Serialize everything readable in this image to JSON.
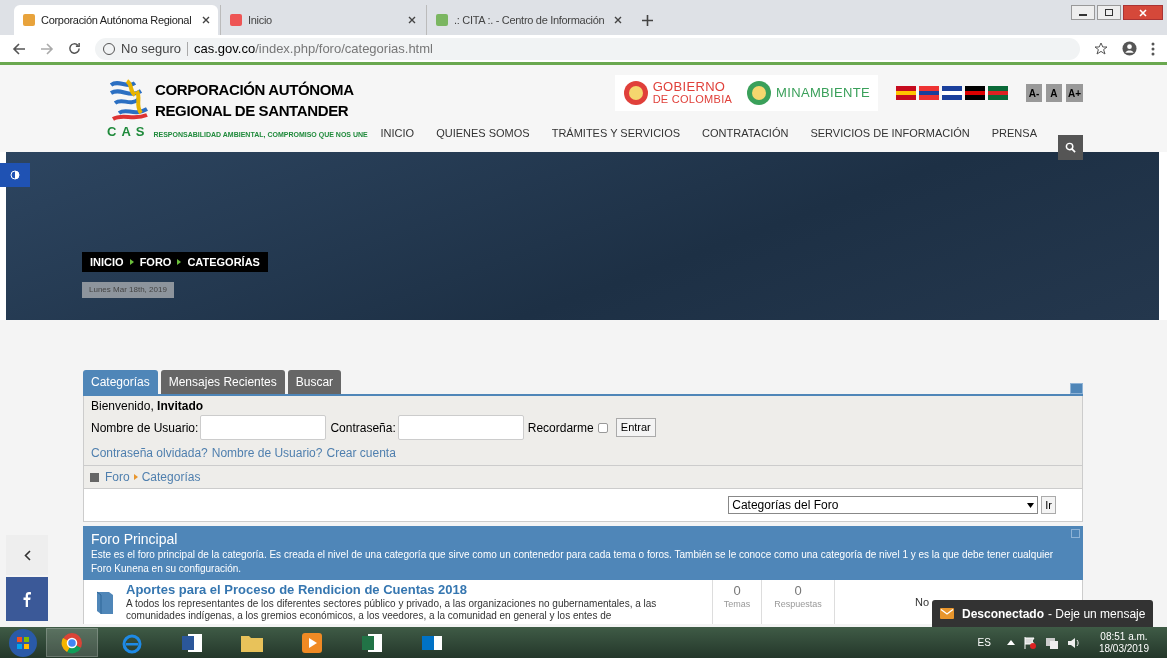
{
  "browser": {
    "tabs": [
      {
        "title": "Corporación Autónoma Regional",
        "selected": true
      },
      {
        "title": "Inicio",
        "selected": false
      },
      {
        "title": ".: CITA :. - Centro de Información",
        "selected": false
      }
    ],
    "security": "No seguro",
    "url_host": "cas.gov.co",
    "url_path": "/index.php/foro/categorias.html"
  },
  "header": {
    "logo_title": [
      "CORPORACIÓN AUTÓNOMA",
      "REGIONAL DE SANTANDER"
    ],
    "logo_letters": "CAS",
    "logo_slogan": "RESPONSABILIDAD AMBIENTAL, COMPROMISO QUE NOS UNE",
    "partners": [
      {
        "line1": "GOBIERNO",
        "line2": "DE COLOMBIA",
        "color": "#e0403a"
      },
      {
        "line1": "MINAMBIENTE",
        "color": "#3aa05a"
      }
    ],
    "font_buttons": [
      "A-",
      "A",
      "A+"
    ],
    "nav": [
      "INICIO",
      "QUIENES SOMOS",
      "TRÁMITES Y SERVICIOS",
      "CONTRATACIÓN",
      "SERVICIOS DE INFORMACIÓN",
      "PRENSA"
    ]
  },
  "hero": {
    "breadcrumb": [
      "INICIO",
      "FORO",
      "CATEGORÍAS"
    ],
    "date": "Lunes Mar 18th, 2019"
  },
  "forum": {
    "tabs": [
      {
        "label": "Categorías",
        "selected": true
      },
      {
        "label": "Mensajes Recientes",
        "selected": false
      },
      {
        "label": "Buscar",
        "selected": false
      }
    ],
    "welcome": "Bienvenido, **Invitado**",
    "username_label": "Nombre de Usuario:",
    "password_label": "Contraseña:",
    "remember_label": "Recordarme",
    "remember_checked": false,
    "login_button": "Entrar",
    "links": [
      "Contraseña olvidada?",
      "Nombre de Usuario?",
      "Crear cuenta"
    ],
    "path": [
      "Foro",
      "Categorías"
    ],
    "jump_select": "Categorías del Foro",
    "jump_button": "Ir",
    "section": {
      "title": "Foro Principal",
      "description": "Este es el foro principal de la categoría. Es creada el nivel de una categoría que sirve como un contenedor para cada tema o foros. También se le conoce como una categoría de nivel 1 y es la que debe tener cualquier Foro Kunena en su configuración."
    },
    "category": {
      "title": "Aportes para el Proceso de Rendicion de Cuentas 2018",
      "description": "A todos los representantes de los diferentes sectores público y privado, a las organizaciones no gubernamentales, a las comunidades indígenas, a los gremios económicos, a los veedores, a la comunidad en general y los entes de",
      "topics": "0",
      "topics_label": "Temas",
      "replies": "0",
      "replies_label": "Respuestas",
      "last_post": "No"
    }
  },
  "chat": {
    "status": "Desconectado",
    "action": "- Deje un mensaje"
  },
  "taskbar": {
    "language": "ES",
    "time": "08:51 a.m.",
    "date": "18/03/2019"
  }
}
